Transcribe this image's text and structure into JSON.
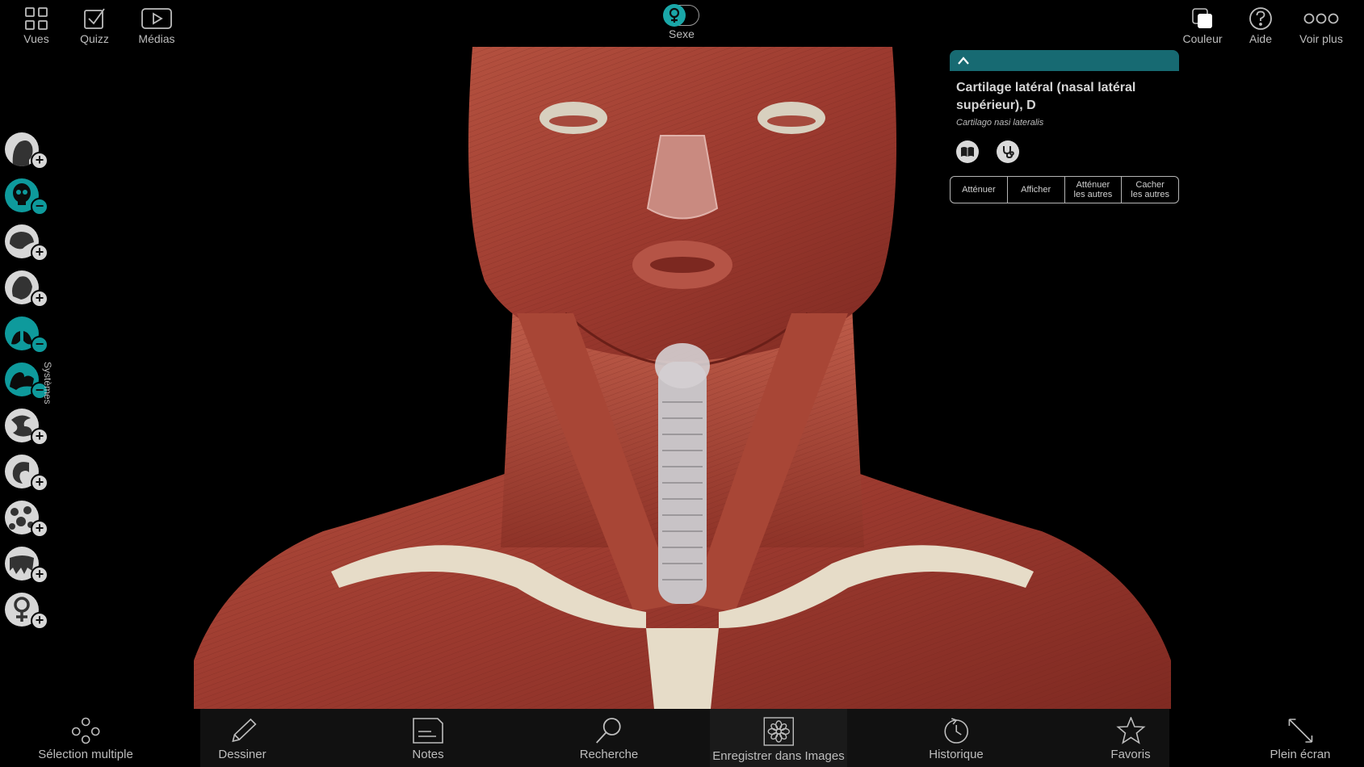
{
  "top_toolbar": {
    "left": [
      {
        "label": "Vues",
        "icon": "grid-icon"
      },
      {
        "label": "Quizz",
        "icon": "checkbox-icon"
      },
      {
        "label": "Médias",
        "icon": "play-icon"
      }
    ],
    "sex_toggle": {
      "label": "Sexe",
      "value": "female"
    },
    "right": [
      {
        "label": "Couleur",
        "icon": "color-squares-icon"
      },
      {
        "label": "Aide",
        "icon": "help-icon"
      },
      {
        "label": "Voir plus",
        "icon": "more-dots-icon"
      }
    ]
  },
  "systems_sidebar": {
    "label": "Systèmes",
    "items": [
      {
        "icon": "skin-head-icon",
        "state": "+",
        "active": false
      },
      {
        "icon": "skeleton-icon",
        "state": "−",
        "active": true
      },
      {
        "icon": "brain-icon",
        "state": "+",
        "active": false
      },
      {
        "icon": "heart-icon",
        "state": "+",
        "active": false
      },
      {
        "icon": "lungs-icon",
        "state": "−",
        "active": true
      },
      {
        "icon": "muscle-icon",
        "state": "−",
        "active": true
      },
      {
        "icon": "digestive-icon",
        "state": "+",
        "active": false
      },
      {
        "icon": "ear-icon",
        "state": "+",
        "active": false
      },
      {
        "icon": "lymph-icon",
        "state": "+",
        "active": false
      },
      {
        "icon": "teeth-icon",
        "state": "+",
        "active": false
      },
      {
        "icon": "female-symbol-icon",
        "state": "+",
        "active": false
      }
    ]
  },
  "info_panel": {
    "collapse_icon": "chevron-up-icon",
    "title": "Cartilage latéral (nasal latéral supérieur), D",
    "latin": "Cartilago nasi lateralis",
    "icons": [
      "book-icon",
      "stethoscope-icon"
    ],
    "actions": [
      "Atténuer",
      "Afficher",
      "Atténuer\nles autres",
      "Cacher\nles autres"
    ]
  },
  "bottom_toolbar": [
    {
      "label": "Sélection multiple",
      "icon": "multi-select-icon"
    },
    {
      "label": "Dessiner",
      "icon": "pencil-icon"
    },
    {
      "label": "Notes",
      "icon": "note-icon"
    },
    {
      "label": "Recherche",
      "icon": "search-icon"
    },
    {
      "label": "Enregistrer dans Images",
      "icon": "flower-icon"
    },
    {
      "label": "Historique",
      "icon": "history-icon"
    },
    {
      "label": "Favoris",
      "icon": "star-icon"
    },
    {
      "label": "Plein écran",
      "icon": "fullscreen-icon"
    }
  ],
  "colors": {
    "accent": "#0e9a9c",
    "panel_header": "#176a72",
    "muscle": "#a8453a",
    "cartilage": "#e6dcc8"
  }
}
